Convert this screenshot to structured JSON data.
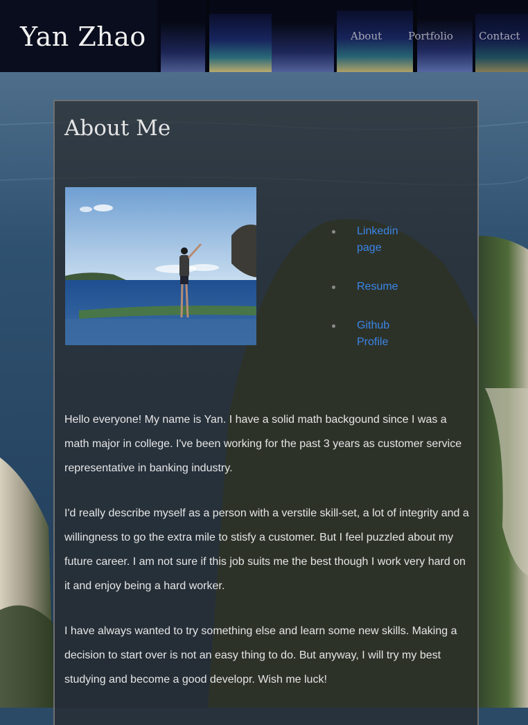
{
  "header": {
    "site_title": "Yan Zhao",
    "nav": [
      {
        "label": "About"
      },
      {
        "label": "Portfolio"
      },
      {
        "label": "Contact"
      }
    ]
  },
  "about": {
    "heading": "About Me",
    "photo": {
      "icon": "profile-photo",
      "alt": ""
    },
    "links": [
      {
        "label": "Linkedin page"
      },
      {
        "label": "Resume"
      },
      {
        "label": "Github Profile"
      }
    ],
    "paragraphs": [
      "Hello everyone! My name is Yan. I have a solid math backgound since I was a math major in college. I've been working for the past 3 years as customer service representative in banking industry.",
      "I'd really describe myself as a person with a verstile skill-set, a lot of integrity and a willingness to go the extra mile to stisfy a customer. But I feel puzzled about my future career. I am not sure if this job suits me the best though I work very hard on it and enjoy being a hard worker.",
      "I have always wanted to try something else and learn some new skills. Making a decision to start over is not an easy thing to do. But anyway, I will try my best studying and become a good developr. Wish me luck!"
    ]
  },
  "colors": {
    "header_bg": "#05070f",
    "link": "#3a86e8",
    "text": "#e6e6e6"
  }
}
